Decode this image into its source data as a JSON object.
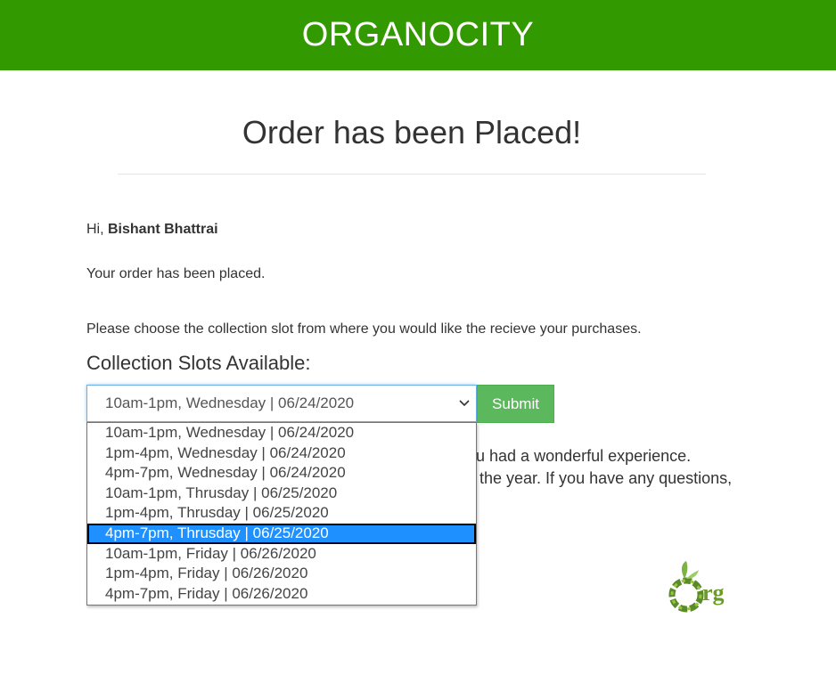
{
  "header": {
    "brand": "ORGANOCITY"
  },
  "main": {
    "title": "Order has been Placed!",
    "greeting_prefix": "Hi, ",
    "customer_name": "Bishant Bhattrai",
    "order_status": "Your order has been placed.",
    "instruction": "Please choose the collection slot from where you would like the recieve your purchases.",
    "slots_label": "Collection Slots Available:",
    "selected_slot": "10am-1pm, Wednesday | 06/24/2020",
    "submit_label": "Submit",
    "partial_text_1": "ou had a wonderful experience.",
    "partial_text_2": "it the year. If you have any questions,"
  },
  "dropdown": {
    "options": [
      "10am-1pm, Wednesday | 06/24/2020",
      "1pm-4pm, Wednesday | 06/24/2020",
      "4pm-7pm, Wednesday | 06/24/2020",
      "10am-1pm, Thrusday | 06/25/2020",
      "1pm-4pm, Thrusday | 06/25/2020",
      "4pm-7pm, Thrusday | 06/25/2020",
      "10am-1pm, Friday | 06/26/2020",
      "1pm-4pm, Friday | 06/26/2020",
      "4pm-7pm, Friday | 06/26/2020"
    ],
    "highlighted": "4pm-7pm, Thrusday | 06/25/2020"
  },
  "logo": {
    "text": "rg"
  },
  "colors": {
    "brand": "#339900",
    "submit": "#5cb85c",
    "highlight": "#1e90ff"
  }
}
